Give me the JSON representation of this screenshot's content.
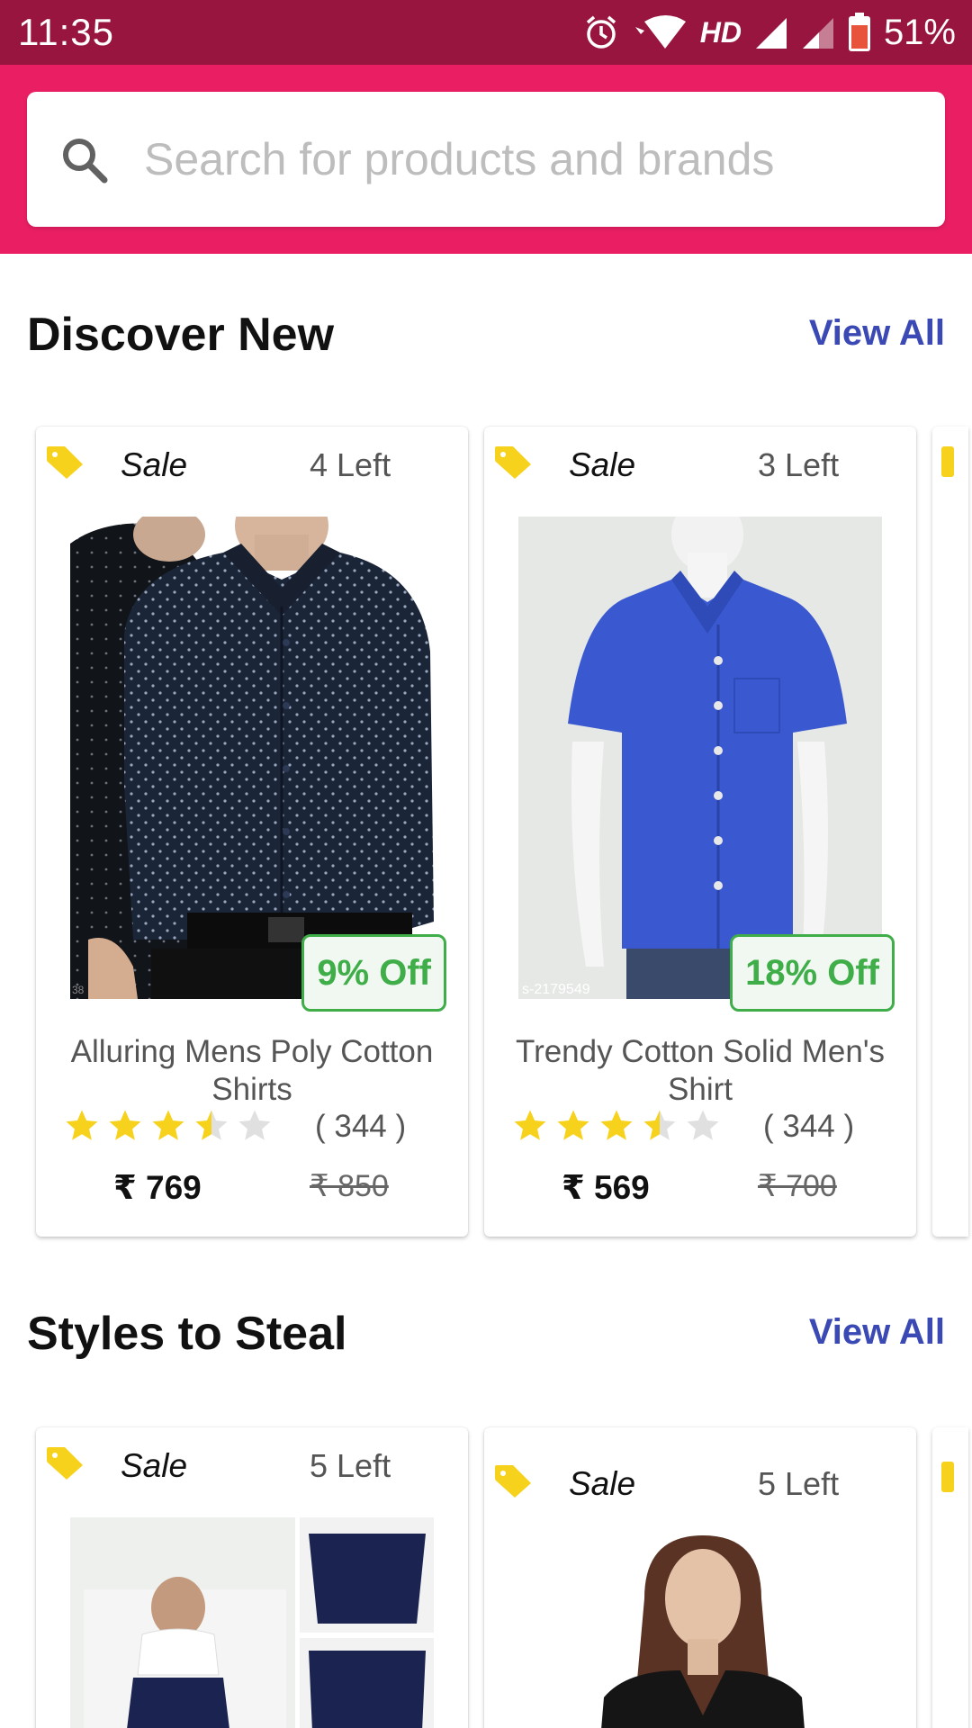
{
  "status_bar": {
    "time": "11:35",
    "network": "HD",
    "battery_percent": "51%"
  },
  "search": {
    "placeholder": "Search for products and brands"
  },
  "sections": [
    {
      "title": "Discover New",
      "view_all": "View All",
      "cards": [
        {
          "sale_label": "Sale",
          "stock_left": "4 Left",
          "discount": "9% Off",
          "name": "Alluring Mens Poly Cotton Shirts",
          "rating": 3.5,
          "reviews": "( 344 )",
          "price": "₹ 769",
          "mrp": "₹ 850"
        },
        {
          "sale_label": "Sale",
          "stock_left": "3 Left",
          "discount": "18% Off",
          "name": "Trendy Cotton Solid Men's Shirt",
          "rating": 3.5,
          "reviews": "( 344 )",
          "price": "₹ 569",
          "mrp": "₹ 700",
          "image_code": "s-2179549"
        }
      ]
    },
    {
      "title": "Styles to Steal",
      "view_all": "View All",
      "cards": [
        {
          "sale_label": "Sale",
          "stock_left": "5 Left"
        },
        {
          "sale_label": "Sale",
          "stock_left": "5 Left"
        }
      ]
    }
  ],
  "colors": {
    "status_bar": "#97153f",
    "header": "#ea1f63",
    "link": "#3a49b4",
    "discount_green": "#3fae49",
    "tag_yellow": "#f7d21d",
    "star": "#f7d21d"
  },
  "icons": [
    "alarm-icon",
    "wifi-icon",
    "signal-icon",
    "battery-icon",
    "search-icon",
    "tag-icon",
    "star-icon"
  ]
}
